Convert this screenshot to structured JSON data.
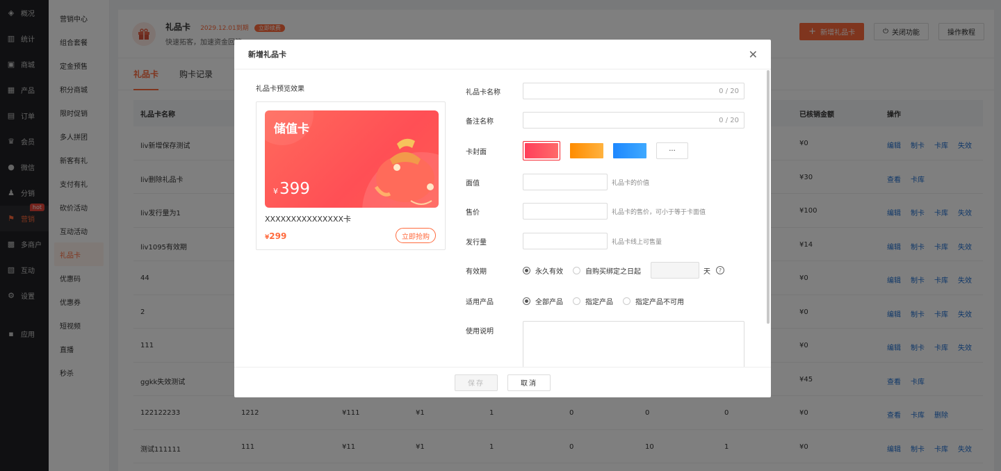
{
  "sidebar": {
    "items": [
      {
        "label": "概况",
        "icon": "layers-icon"
      },
      {
        "label": "统计",
        "icon": "chart-icon"
      },
      {
        "label": "商城",
        "icon": "shop-icon"
      },
      {
        "label": "产品",
        "icon": "grid-icon"
      },
      {
        "label": "订单",
        "icon": "order-icon"
      },
      {
        "label": "会员",
        "icon": "crown-icon"
      },
      {
        "label": "微信",
        "icon": "wechat-icon"
      },
      {
        "label": "分销",
        "icon": "distribute-icon"
      },
      {
        "label": "营销",
        "icon": "flag-icon"
      },
      {
        "label": "多商户",
        "icon": "merchant-icon"
      },
      {
        "label": "互动",
        "icon": "interact-icon"
      },
      {
        "label": "设置",
        "icon": "gear-icon"
      },
      {
        "label": "应用",
        "icon": "apps-icon"
      }
    ],
    "hot_badge": "hot"
  },
  "submenu": {
    "items": [
      "营销中心",
      "组合套餐",
      "定金预售",
      "积分商城",
      "限时促销",
      "多人拼团",
      "新客有礼",
      "支付有礼",
      "砍价活动",
      "互动活动",
      "礼品卡",
      "优惠码",
      "优惠券",
      "短视频",
      "直播",
      "秒杀"
    ]
  },
  "header": {
    "title": "礼品卡",
    "expire": "2029.12.01到期",
    "renew": "立即续费",
    "subtitle": "快速拓客，加速资金回笼",
    "add_button": "新增礼品卡",
    "close_button": "关闭功能",
    "tutorial_button": "操作教程"
  },
  "tabs": [
    "礼品卡",
    "购卡记录"
  ],
  "table": {
    "col_name": "礼品卡名称",
    "col_used": "已核销金额",
    "col_ops": "操作",
    "rows": [
      {
        "name": "liv新增保存测试",
        "c2": "",
        "c3": "",
        "c4": "",
        "c5": "",
        "c6": "",
        "c7": "",
        "c8": "",
        "used": "¥0",
        "ops": [
          "编辑",
          "制卡",
          "卡库",
          "失效"
        ]
      },
      {
        "name": "liv删除礼品卡",
        "c2": "",
        "c3": "",
        "c4": "",
        "c5": "",
        "c6": "",
        "c7": "",
        "c8": "",
        "used": "¥30",
        "ops": [
          "查看",
          "卡库"
        ]
      },
      {
        "name": "liv发行量为1",
        "c2": "",
        "c3": "",
        "c4": "",
        "c5": "",
        "c6": "",
        "c7": "",
        "c8": "",
        "used": "¥100",
        "ops": [
          "编辑",
          "制卡",
          "卡库",
          "失效"
        ]
      },
      {
        "name": "liv1095有效期",
        "c2": "",
        "c3": "",
        "c4": "",
        "c5": "",
        "c6": "",
        "c7": "",
        "c8": "",
        "used": "¥14",
        "ops": [
          "编辑",
          "制卡",
          "卡库",
          "失效"
        ]
      },
      {
        "name": "44",
        "c2": "",
        "c3": "",
        "c4": "",
        "c5": "",
        "c6": "",
        "c7": "",
        "c8": "",
        "used": "¥0",
        "ops": [
          "编辑",
          "制卡",
          "卡库",
          "失效"
        ]
      },
      {
        "name": "2",
        "c2": "",
        "c3": "",
        "c4": "",
        "c5": "",
        "c6": "",
        "c7": "",
        "c8": "",
        "used": "¥0",
        "ops": [
          "编辑",
          "制卡",
          "卡库",
          "失效"
        ]
      },
      {
        "name": "111",
        "c2": "",
        "c3": "",
        "c4": "",
        "c5": "",
        "c6": "",
        "c7": "",
        "c8": "",
        "used": "¥0",
        "ops": [
          "编辑",
          "制卡",
          "卡库",
          "失效"
        ]
      },
      {
        "name": "ggkk失效测试",
        "c2": "",
        "c3": "",
        "c4": "",
        "c5": "",
        "c6": "",
        "c7": "",
        "c8": "",
        "used": "¥45",
        "ops": [
          "查看",
          "卡库"
        ]
      },
      {
        "name": "122122233",
        "c2": "1212",
        "c3": "¥111",
        "c4": "¥1",
        "c5": "1",
        "c6": "0",
        "c7": "0",
        "c8": "0",
        "used": "¥0",
        "ops": [
          "查看",
          "卡库",
          "删除"
        ]
      },
      {
        "name": "测试111111",
        "c2": "111",
        "c3": "¥11",
        "c4": "¥1",
        "c5": "1",
        "c6": "0",
        "c7": "10",
        "c8": "1",
        "used": "¥0",
        "ops": [
          "编辑",
          "制卡",
          "卡库",
          "失效"
        ]
      }
    ]
  },
  "modal": {
    "title": "新增礼品卡",
    "preview_label": "礼品卡预览效果",
    "card_title": "储值卡",
    "card_currency": "¥",
    "card_value": "399",
    "card_name": "XXXXXXXXXXXXXXX卡",
    "sell_currency": "¥",
    "sell_price": "299",
    "buy_button": "立即抢购",
    "form": {
      "name_label": "礼品卡名称",
      "name_counter": "0 / 20",
      "remark_label": "备注名称",
      "remark_counter": "0 / 20",
      "cover_label": "卡封面",
      "cover_colors": [
        "#ff4d5e",
        "#ff9b1a",
        "#2196f3"
      ],
      "cover_more": "···",
      "face_label": "面值",
      "face_hint": "礼品卡的价值",
      "price_label": "售价",
      "price_hint": "礼品卡的售价，可小于等于卡面值",
      "issue_label": "发行量",
      "issue_hint": "礼品卡线上可售量",
      "validity_label": "有效期",
      "validity_opt1": "永久有效",
      "validity_opt2": "自购买绑定之日起",
      "validity_unit": "天",
      "help": "?",
      "product_label": "适用产品",
      "product_opt1": "全部产品",
      "product_opt2": "指定产品",
      "product_opt3": "指定产品不可用",
      "desc_label": "使用说明"
    },
    "save_button": "保存",
    "cancel_button": "取消"
  }
}
